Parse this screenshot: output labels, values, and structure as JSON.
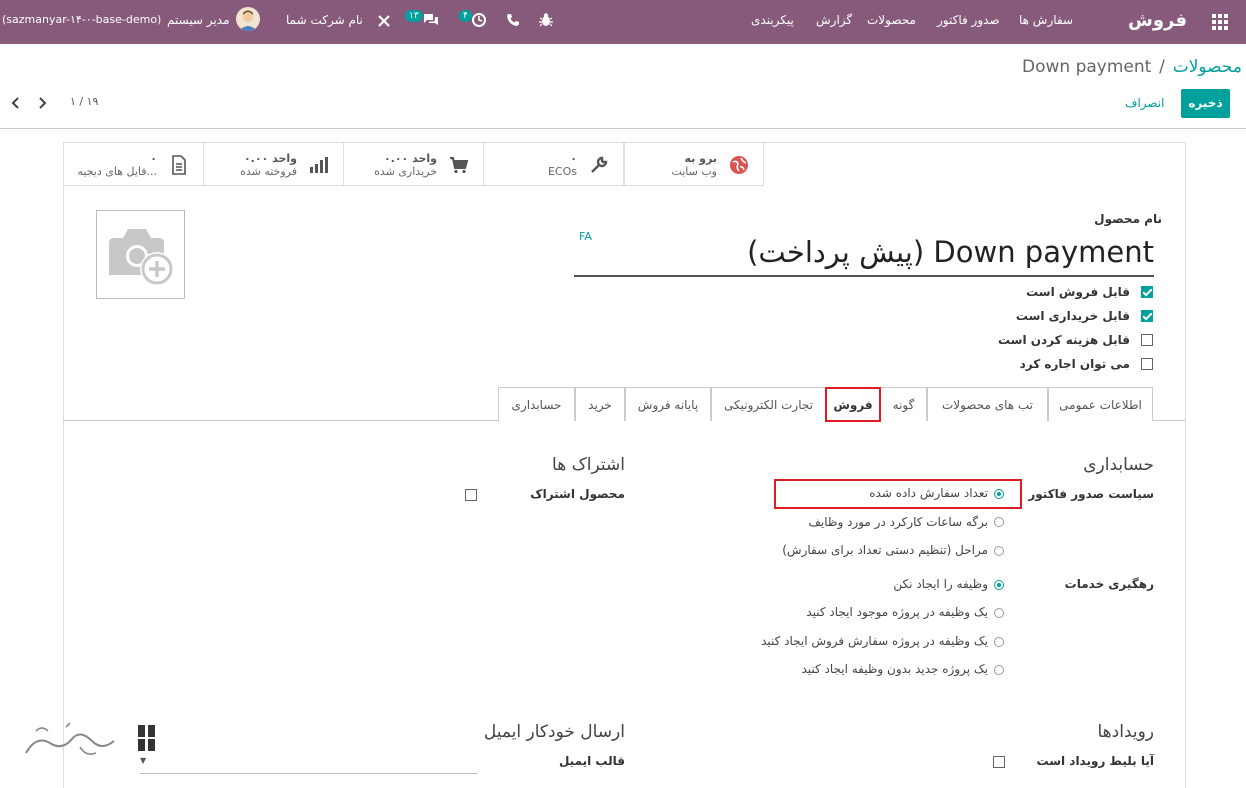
{
  "topbar": {
    "app_name": "فروش",
    "menu": [
      "سفارش ها",
      "صدور فاکتور",
      "محصولات",
      "گزارش",
      "پیکربندی"
    ],
    "company": "نام شرکت شما",
    "user": "مدیر سیستم",
    "db": "(sazmanyar-۱۴-۰-base-demo)",
    "activity_count": "۴",
    "message_count": "۱۳"
  },
  "breadcrumb": {
    "parent": "محصولات",
    "sep": "/",
    "current": "Down payment"
  },
  "actions": {
    "save": "ذخیره",
    "discard": "انصراف"
  },
  "pager": {
    "value": "۱ / ۱۹"
  },
  "stat_buttons": [
    {
      "value": "برو به",
      "label": "وب سایت",
      "icon": "globe-icon"
    },
    {
      "value": "۰",
      "label": "ECOs",
      "icon": "wrench-icon"
    },
    {
      "value": "۰.۰۰ واحد",
      "label": "خریداری شده",
      "icon": "cart-icon"
    },
    {
      "value": "۰.۰۰ واحد",
      "label": "فروخته شده",
      "icon": "bar-chart-icon"
    },
    {
      "value": "۰",
      "label": "فایل های دیجیه...",
      "icon": "file-icon"
    }
  ],
  "product": {
    "name_label": "نام محصول",
    "name": "Down payment (پیش پرداخت)",
    "lang": "FA",
    "flags": [
      {
        "label": "قابل فروش است",
        "checked": true
      },
      {
        "label": "قابل خریداری است",
        "checked": true
      },
      {
        "label": "قابل هزینه کردن است",
        "checked": false
      },
      {
        "label": "می توان اجاره کرد",
        "checked": false
      }
    ]
  },
  "tabs": [
    "اطلاعات عمومی",
    "تب های محصولات",
    "گونه",
    "فروش",
    "تجارت الکترونیکی",
    "پایانه فروش",
    "خرید",
    "حسابداری"
  ],
  "active_tab": "فروش",
  "sales_tab": {
    "accounting_title": "حسابداری",
    "invoice_policy_label": "سیاست صدور فاکتور",
    "invoice_policy_options": [
      {
        "label": "تعداد سفارش داده شده",
        "selected": true
      },
      {
        "label": "برگه ساعات کارکرد در مورد وظایف",
        "selected": false
      },
      {
        "label": "مراحل (تنظیم دستی تعداد برای سفارش)",
        "selected": false
      }
    ],
    "service_tracking_label": "رهگیری خدمات",
    "service_tracking_options": [
      {
        "label": "وظیفه را ایجاد نکن",
        "selected": true
      },
      {
        "label": "یک وظیفه در پروژه موجود ایجاد کنید",
        "selected": false
      },
      {
        "label": "یک وظیفه در پروژه سفارش فروش ایجاد کنید",
        "selected": false
      },
      {
        "label": "یک پروژه جدید بدون وظیفه ایجاد کنید",
        "selected": false
      }
    ],
    "subscriptions_title": "اشتراک ها",
    "subscription_product_label": "محصول اشتراک",
    "events_title": "رویدادها",
    "is_event_ticket_label": "آیا بلیط رویداد است",
    "auto_email_title": "ارسال خودکار ایمیل",
    "email_template_label": "قالب ایمیل"
  },
  "colors": {
    "brand": "#875a7b",
    "accent": "#00a09d",
    "highlight": "#e01b24"
  }
}
